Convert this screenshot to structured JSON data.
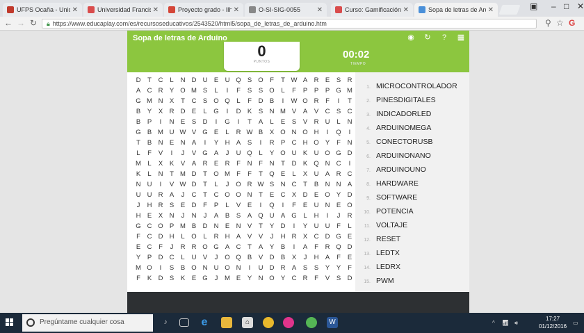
{
  "browser": {
    "tabs": [
      {
        "title": "UFPS Ocaña - Unidad d",
        "color": "#c0392b"
      },
      {
        "title": "Universidad Francisco d",
        "color": "#d94c4c"
      },
      {
        "title": "Proyecto grado - lIhem",
        "color": "#d44638"
      },
      {
        "title": "O-SI-SIG-0055",
        "color": "#888888"
      },
      {
        "title": "Curso: Gamificación",
        "color": "#d94c4c"
      },
      {
        "title": "Sopa de letras de Ardu",
        "color": "#4a90d9"
      }
    ],
    "url": "https://www.educaplay.com/es/recursoseducativos/2543520/html5/sopa_de_letras_de_arduino.htm"
  },
  "game": {
    "title": "Sopa de letras de Arduino",
    "score": "0",
    "score_label": "PUNTOS",
    "time": "00:02",
    "time_label": "TIEMPO",
    "grid": [
      "DTCLNDUEUQSOFTWARESR",
      "ACRYOMSLIFSSOLFPPPGM",
      "GMNXTCSOQLFDBIWORFIT",
      "BYXRDELGIDKSNMVAVCSC",
      "BPINESDIGITALESVRULN",
      "GBMUWVGELRWBXONOHIQI",
      "TBNENAIYHASIRPCHOYFN",
      "LFVIJVGAJUQLYOUKUOGD",
      "MLXKVARERFNFNTDKQNCI",
      "KLNTMDTOMFFTQELXUARC",
      "NUIVWDTLJORWSNCTBNNA",
      "UURAJCTCOONTECXDEOYD",
      "JHRSEDFPLVEIQIFEUNEO",
      "HEXNJNJABSAQUAGLHIJR",
      "GCOPMBDNENVTYDIYUUFL",
      "FCDHLOLRHAVVJHRXCDGE",
      "ECFJRROGACTAYBIAFRQD",
      "YPDCLUVJOQBVDBXJHAFE",
      "MOISBONUONIUDRASSYYF",
      "FKDSKEGJMEYNOYCRFVSD"
    ],
    "words": [
      {
        "num": "1.",
        "text": "MICROCONTROLADOR"
      },
      {
        "num": "2.",
        "text": "PINESDIGITALES"
      },
      {
        "num": "3.",
        "text": "INDICADORLED"
      },
      {
        "num": "4.",
        "text": "ARDUINOMEGA"
      },
      {
        "num": "5.",
        "text": "CONECTORUSB"
      },
      {
        "num": "6.",
        "text": "ARDUINONANO"
      },
      {
        "num": "7.",
        "text": "ARDUINOUNO"
      },
      {
        "num": "8.",
        "text": "HARDWARE"
      },
      {
        "num": "9.",
        "text": "SOFTWARE"
      },
      {
        "num": "10.",
        "text": "POTENCIA"
      },
      {
        "num": "11.",
        "text": "VOLTAJE"
      },
      {
        "num": "12.",
        "text": "RESET"
      },
      {
        "num": "13.",
        "text": "LEDTX"
      },
      {
        "num": "14.",
        "text": "LEDRX"
      },
      {
        "num": "15.",
        "text": "PWM"
      }
    ],
    "accent_color": "#8cc63f"
  },
  "taskbar": {
    "search_placeholder": "Pregúntame cualquier cosa",
    "time": "17:27",
    "date": "01/12/2016"
  }
}
